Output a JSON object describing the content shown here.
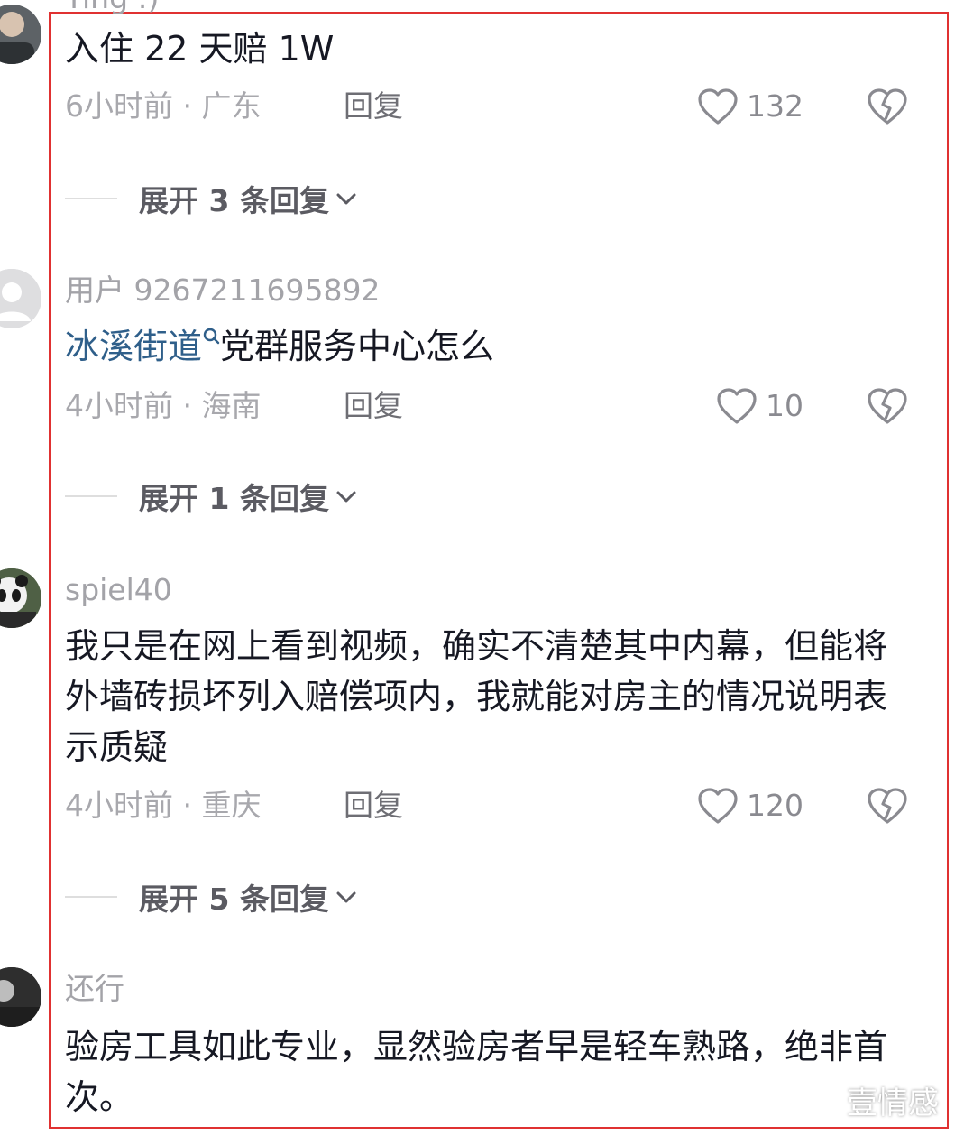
{
  "top_partial_username": "Ying :)",
  "comments": [
    {
      "username": "",
      "text": "入住 22 天赔 1W",
      "time": "6小时前",
      "location": "广东",
      "reply_label": "回复",
      "likes": "132",
      "expand_label": "展开 3 条回复"
    },
    {
      "username": "用户 9267211695892",
      "link_text": "冰溪街道",
      "text_rest": "党群服务中心怎么",
      "time": "4小时前",
      "location": "海南",
      "reply_label": "回复",
      "likes": "10",
      "expand_label": "展开 1 条回复"
    },
    {
      "username": "spiel40",
      "text": "我只是在网上看到视频，确实不清楚其中内幕，但能将外墙砖损坏列入赔偿项内，我就能对房主的情况说明表示质疑",
      "time": "4小时前",
      "location": "重庆",
      "reply_label": "回复",
      "likes": "120",
      "expand_label": "展开 5 条回复"
    },
    {
      "username": "还行",
      "text": "验房工具如此专业，显然验房者早是轻车熟路，绝非首次。"
    }
  ],
  "separator": " · ",
  "watermark": "壹情感",
  "colors": {
    "frame": "#e03131",
    "link": "#2f5f8a",
    "text": "#161823",
    "meta": "#a8a8ad"
  }
}
